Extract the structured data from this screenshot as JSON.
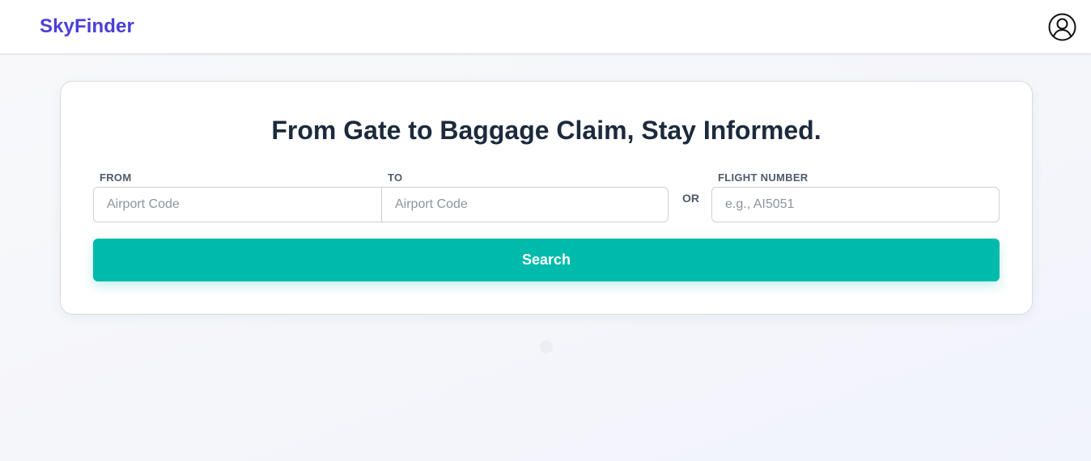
{
  "header": {
    "brand": "SkyFinder",
    "account_icon": "user-circle-icon"
  },
  "search": {
    "headline": "From Gate to Baggage Claim, Stay Informed.",
    "from_label": "FROM",
    "from_placeholder": "Airport Code",
    "from_value": "",
    "to_label": "TO",
    "to_placeholder": "Airport Code",
    "to_value": "",
    "or_text": "OR",
    "flight_label": "FLIGHT NUMBER",
    "flight_placeholder": "e.g., AI5051",
    "flight_value": "",
    "button_label": "Search"
  },
  "colors": {
    "brand": "#4b3fd8",
    "accent": "#00bbac",
    "heading": "#1c2a3c"
  }
}
